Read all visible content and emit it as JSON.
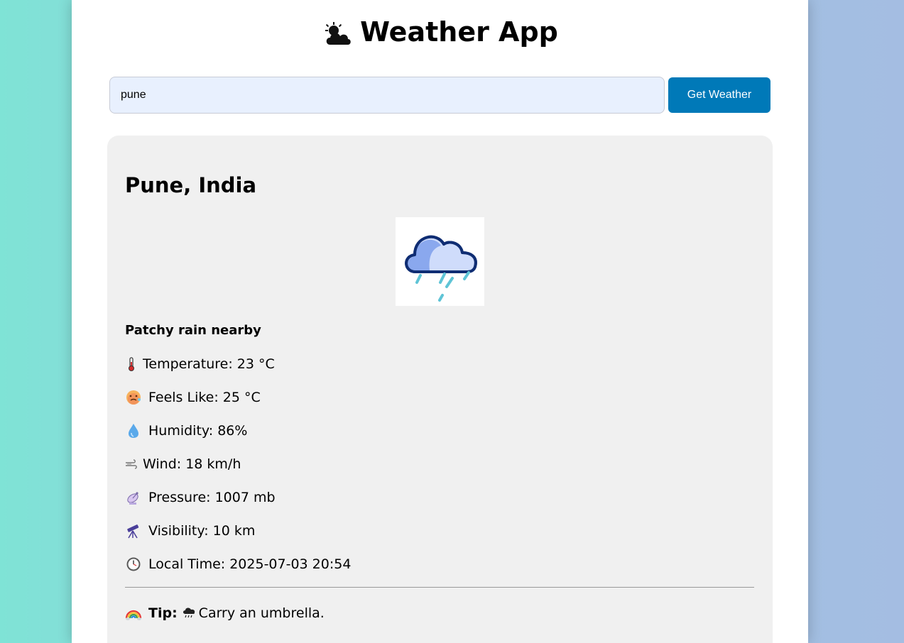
{
  "app": {
    "title": "Weather App",
    "title_icon": "sun-behind-cloud-icon"
  },
  "search": {
    "value": "pune",
    "button_label": "Get Weather"
  },
  "weather": {
    "location": "Pune, India",
    "condition_icon": "rain-cloud-icon",
    "condition": "Patchy rain nearby",
    "details": [
      {
        "icon": "thermometer-icon",
        "text": "Temperature: 23 °C"
      },
      {
        "icon": "hot-face-icon",
        "text": "Feels Like: 25 °C"
      },
      {
        "icon": "droplet-icon",
        "text": "Humidity: 86%"
      },
      {
        "icon": "wind-icon",
        "text": "Wind: 18 km/h"
      },
      {
        "icon": "satellite-antenna-icon",
        "text": "Pressure: 1007 mb"
      },
      {
        "icon": "telescope-icon",
        "text": "Visibility: 10 km"
      },
      {
        "icon": "clock-icon",
        "text": "Local Time: 2025-07-03 20:54"
      }
    ],
    "tip": {
      "icon": "rainbow-icon",
      "label": "Tip:",
      "text_icon": "cloud-with-rain-icon",
      "text": "Carry an umbrella."
    }
  },
  "colors": {
    "button": "#0079b8",
    "input_bg": "#e8f0fe",
    "card_bg": "#f0f0f0"
  }
}
